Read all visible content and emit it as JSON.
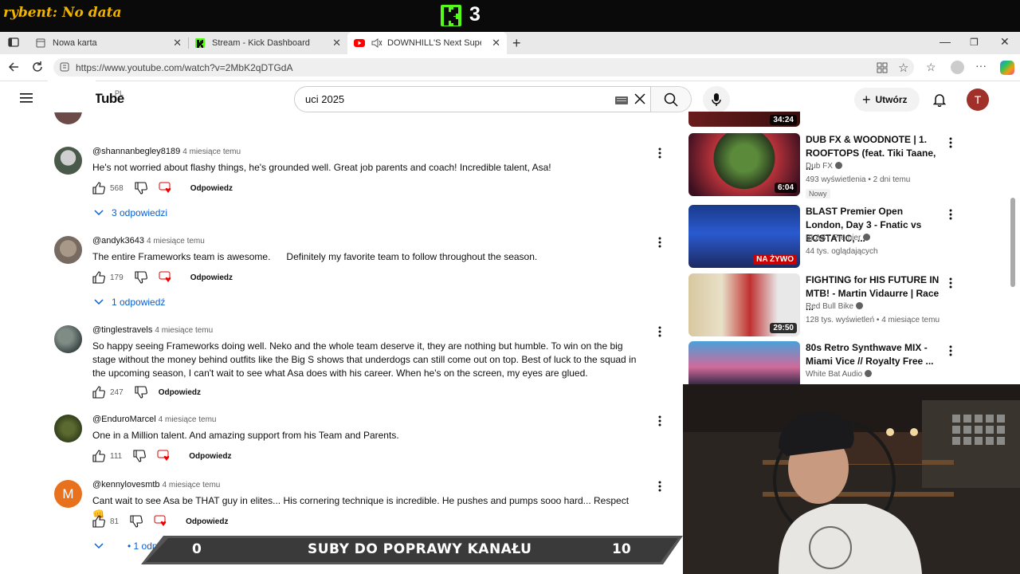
{
  "overlay": {
    "left_text": "rybent: No data",
    "kick_count": "3"
  },
  "tabs": [
    {
      "label": "Nowa karta",
      "icon": "page-icon"
    },
    {
      "label": "Stream - Kick Dashboard",
      "icon": "kick-icon"
    },
    {
      "label": "DOWNHILL'S Next Supersta",
      "icon": "youtube-icon"
    }
  ],
  "address": {
    "url": "https://www.youtube.com/watch?v=2MbK2qDTGdA"
  },
  "youtube": {
    "logo": "YouTube",
    "region": "PL",
    "search_value": "uci 2025",
    "create_label": "Utwórz",
    "avatar_letter": "T"
  },
  "comments": [
    {
      "user": "@shannanbegley8189",
      "time": "4 miesiące temu",
      "text": "He's not worried about flashy things, he's grounded well. Great job parents and coach! Incredible talent, Asa!",
      "likes": "568",
      "reply": "Odpowiedz",
      "replies": "3 odpowiedzi",
      "heart": true
    },
    {
      "user": "@andyk3643",
      "time": "4 miesiące temu",
      "text": "The entire Frameworks team is awesome.      Definitely my favorite team to follow throughout the season.",
      "likes": "179",
      "reply": "Odpowiedz",
      "replies": "1 odpowiedź",
      "heart": true
    },
    {
      "user": "@tinglestravels",
      "time": "4 miesiące temu",
      "text": "So happy seeing Frameworks doing well. Neko and the whole team deserve it, they are nothing but humble. To win on the big stage without the money behind outfits like the Big S shows that underdogs can still come out on top. Best of luck to the squad in the upcoming season, I can't wait to see what Asa does with his career. When he's on the screen, my eyes are glued.",
      "likes": "247",
      "reply": "Odpowiedz",
      "replies": "",
      "heart": false
    },
    {
      "user": "@EnduroMarcel",
      "time": "4 miesiące temu",
      "text": "One in a Million talent. And amazing support from his Team and Parents.",
      "likes": "111",
      "reply": "Odpowiedz",
      "replies": "",
      "heart": true
    },
    {
      "user": "@kennylovesmtb",
      "time": "4 miesiące temu",
      "text": "Cant wait to see Asa be THAT guy in elites... His cornering technique is incredible. He pushes and pumps sooo hard... Respect 👊",
      "likes": "81",
      "reply": "Odpowiedz",
      "replies": "• 1 odpowiedź",
      "heart": true,
      "avatar_letter": "M"
    }
  ],
  "sidebar": [
    {
      "duration": "34:24"
    },
    {
      "title": "DUB FX & WOODNOTE | 1. ROOFTOPS (feat. Tiki Taane, ...",
      "channel": "Dub FX",
      "meta": "493 wyświetlenia • 2 dni temu",
      "badge": "Nowy",
      "duration": "6:04"
    },
    {
      "title": "BLAST Premier Open London, Day 3 - Fnatic vs ECSTATIC, ...",
      "channel": "BLAST Premier",
      "meta": "44 tys. oglądających",
      "duration": "NA ŻYWO"
    },
    {
      "title": "FIGHTING for HIS FUTURE IN MTB! - Martin Vidaurre | Race ...",
      "channel": "Red Bull Bike",
      "meta": "128 tys. wyświetleń • 4 miesiące temu",
      "duration": "29:50"
    },
    {
      "title": "80s Retro Synthwave MIX - Miami Vice // Royalty Free ...",
      "channel": "White Bat Audio",
      "meta": ""
    }
  ],
  "banner": {
    "left": "0",
    "middle": "SUBY DO POPRAWY KANAŁU",
    "right": "10"
  },
  "colors": {
    "kick_green": "#53fc18",
    "yt_red": "#ff0000",
    "link_blue": "#065fd4"
  }
}
